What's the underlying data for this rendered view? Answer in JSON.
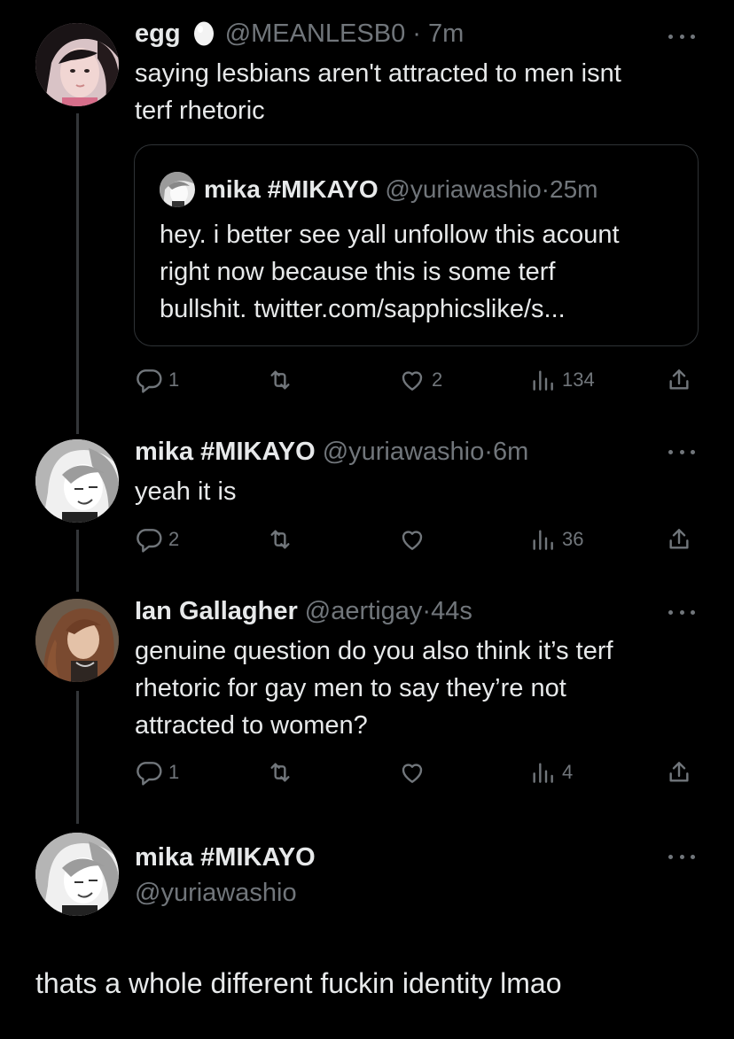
{
  "tweets": [
    {
      "name": "egg",
      "emoji": "egg",
      "handle": "@MEANLESB0",
      "separator": "·",
      "time": "7m",
      "text_lines": [
        "saying lesbians aren't attracted to men isnt",
        "terf rhetoric"
      ],
      "quote": {
        "name": "mika #MIKAYO",
        "handle": "@yuriawashio",
        "separator": "·",
        "time": "25m",
        "text_lines": [
          "hey. i better see yall unfollow this acount",
          "right now because this is some terf",
          "bullshit. twitter.com/sapphicslike/s..."
        ]
      },
      "replies": "1",
      "retweets": "",
      "likes": "2",
      "views": "134"
    },
    {
      "name": "mika #MIKAYO",
      "handle": "@yuriawashio",
      "separator": "·",
      "time": "6m",
      "text_lines": [
        "yeah it is"
      ],
      "replies": "2",
      "retweets": "",
      "likes": "",
      "views": "36"
    },
    {
      "name": "Ian Gallagher",
      "handle": "@aertigay",
      "separator": "·",
      "time": "44s",
      "text_lines": [
        "genuine question do you also think it’s terf",
        "rhetoric for gay men to say they’re not",
        "attracted to women?"
      ],
      "replies": "1",
      "retweets": "",
      "likes": "",
      "views": "4"
    }
  ],
  "focused": {
    "name": "mika #MIKAYO",
    "handle": "@yuriawashio",
    "text": "thats a whole different fuckin identity lmao"
  },
  "colors": {
    "background": "#000000",
    "text": "#e7e9ea",
    "muted": "#71767b",
    "border": "#2f3336"
  },
  "icons": [
    "reply-icon",
    "retweet-icon",
    "like-icon",
    "views-icon",
    "share-icon",
    "more-icon",
    "egg-icon"
  ]
}
